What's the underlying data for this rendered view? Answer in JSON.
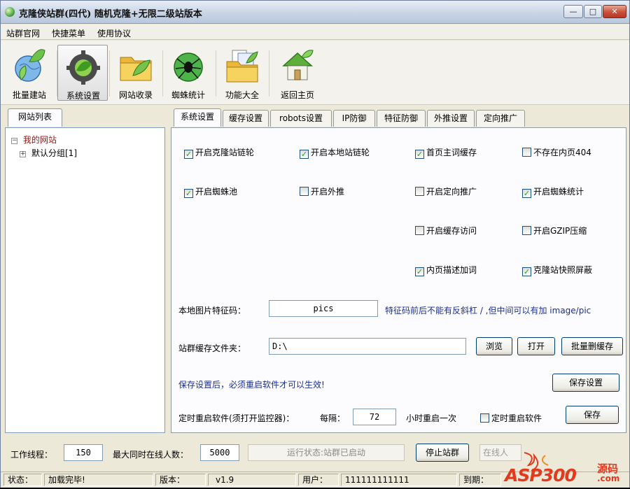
{
  "window": {
    "title": "克隆侠站群(四代) 随机克隆+无限二级站版本",
    "min_label": "—",
    "max_label": "□",
    "close_label": "✕"
  },
  "menu": [
    "站群官网",
    "快捷菜单",
    "使用协议"
  ],
  "toolbar": [
    {
      "label": "批量建站",
      "icon": "globe-leaf-icon"
    },
    {
      "label": "系统设置",
      "icon": "gear-icon"
    },
    {
      "label": "网站收录",
      "icon": "folder-icon"
    },
    {
      "label": "蜘蛛统计",
      "icon": "spider-icon"
    },
    {
      "label": "功能大全",
      "icon": "folder-docs-icon"
    },
    {
      "label": "返回主页",
      "icon": "home-icon"
    }
  ],
  "left": {
    "tab": "网站列表",
    "tree": [
      {
        "label": "我的网站",
        "toggle": "⊟",
        "color": "#8b1a1a"
      },
      {
        "label": "默认分组[1]",
        "toggle": "⊞",
        "color": "#000000"
      }
    ]
  },
  "tabs": [
    "系统设置",
    "缓存设置",
    "robots设置",
    "IP防御",
    "特征防御",
    "外推设置",
    "定向推广"
  ],
  "checkboxes": [
    {
      "label": "开启克隆站链轮",
      "checked": true
    },
    {
      "label": "开启本地站链轮",
      "checked": true
    },
    {
      "label": "首页主词缓存",
      "checked": true
    },
    {
      "label": "不存在内页404",
      "checked": false
    },
    {
      "label": "开启蜘蛛池",
      "checked": true
    },
    {
      "label": "开启外推",
      "checked": false
    },
    {
      "label": "开启定向推广",
      "checked": false
    },
    {
      "label": "开启蜘蛛统计",
      "checked": true
    },
    {
      "label": "开启缓存访问",
      "checked": false
    },
    {
      "label": "开启GZIP压缩",
      "checked": false
    },
    {
      "label": "内页描述加词",
      "checked": true
    },
    {
      "label": "克隆站快照屏蔽",
      "checked": true
    }
  ],
  "image_code": {
    "label": "本地图片特征码：",
    "value": "pics",
    "hint": "特征码前后不能有反斜杠 / ,但中间可以有加 image/pic"
  },
  "cache_folder": {
    "label": "站群缓存文件夹：",
    "value": "D:\\",
    "browse": "浏览",
    "open": "打开",
    "batch_delete": "批量删缓存"
  },
  "save_notice": "保存设置后，必须重启软件才可以生效!",
  "save_settings": "保存设置",
  "restart": {
    "label": "定时重启软件(须打开监控器)：",
    "interval_label": "每隔：",
    "interval_value": "72",
    "unit": "小时重启一次",
    "checkbox": "定时重启软件",
    "save": "保存"
  },
  "bottom": {
    "threads_label": "工作线程：",
    "threads_value": "150",
    "max_online_label": "最大同时在线人数：",
    "max_online_value": "5000",
    "run_status": "运行状态:站群已启动",
    "stop_button": "停止站群",
    "online_field": "在线人"
  },
  "statusbar": {
    "status_label": "状态：",
    "status_value": "加载完毕!",
    "version_label": "版本：",
    "version_value": "v1.9",
    "user_label": "用户：",
    "user_value": "111111111111",
    "expire_label": "到期："
  },
  "watermark": {
    "brand": "ASP300",
    "cn": "源码",
    "domain": ".com"
  }
}
